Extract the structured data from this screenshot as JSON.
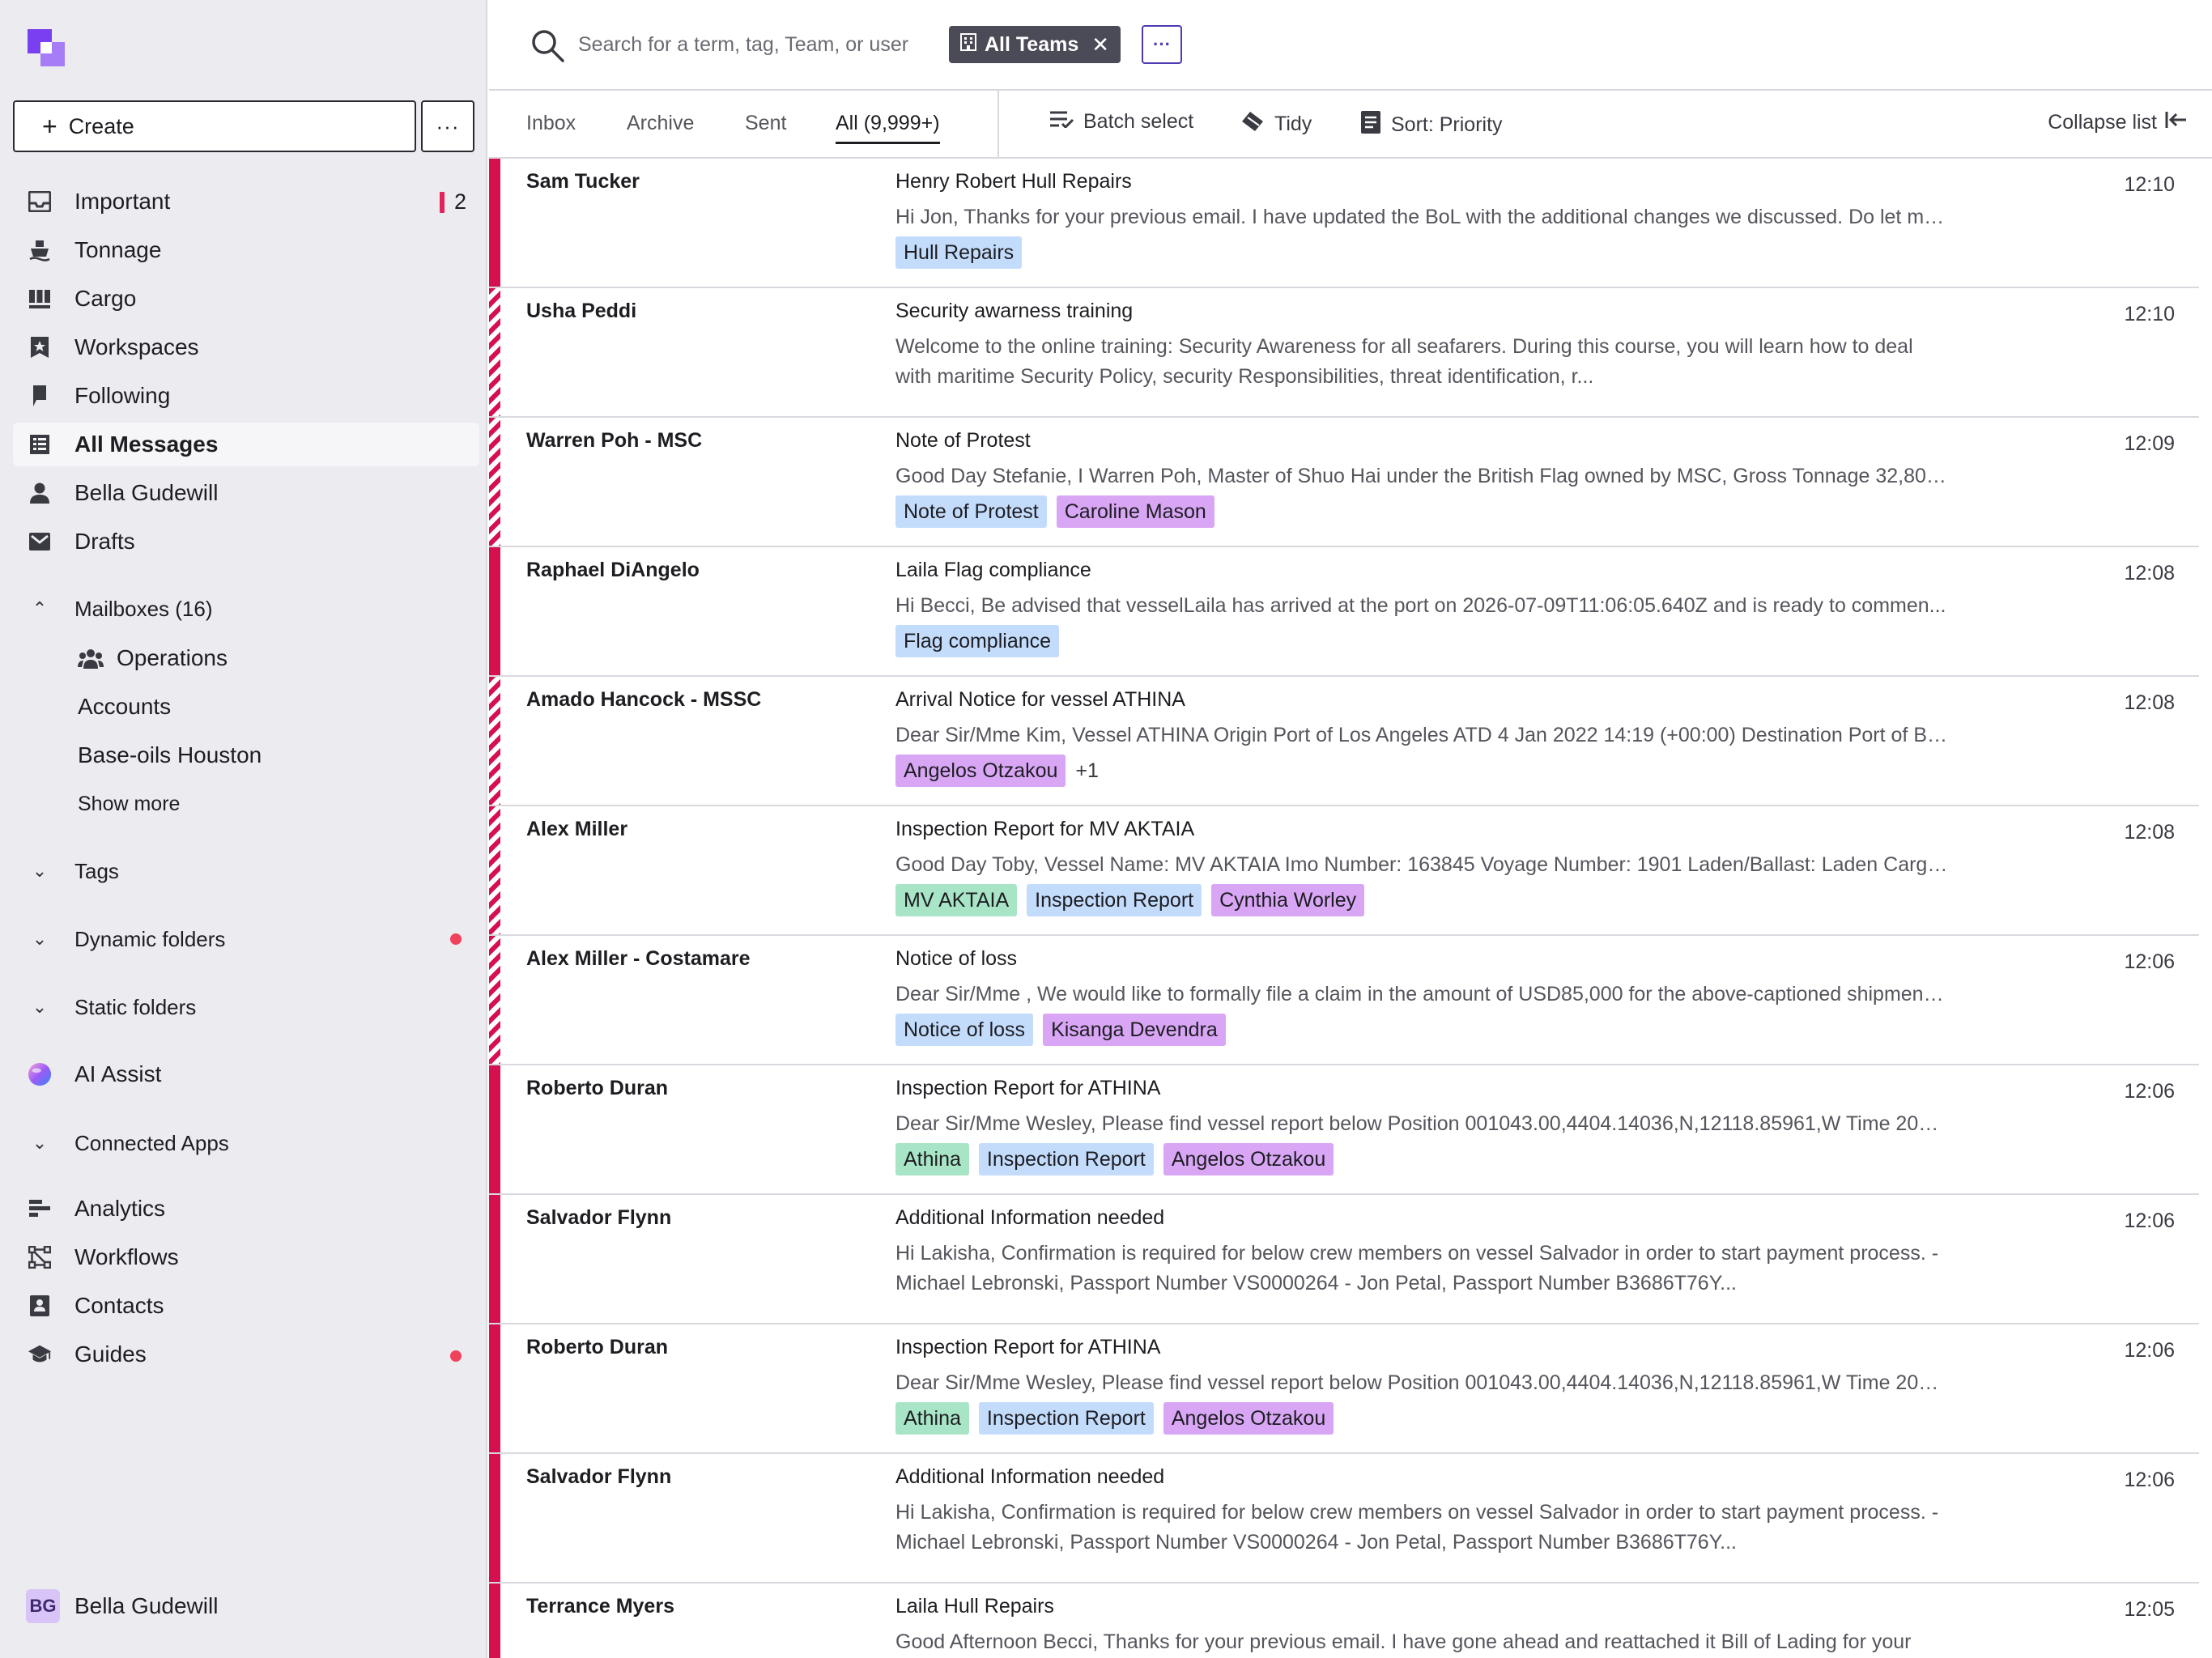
{
  "sidebar": {
    "create_label": "Create",
    "more_label": "···",
    "nav": [
      {
        "label": "Important",
        "icon": "inbox-icon",
        "count": "2"
      },
      {
        "label": "Tonnage",
        "icon": "ship-icon"
      },
      {
        "label": "Cargo",
        "icon": "cargo-icon"
      },
      {
        "label": "Workspaces",
        "icon": "workspace-star-icon"
      },
      {
        "label": "Following",
        "icon": "bookmark-icon"
      },
      {
        "label": "All Messages",
        "icon": "grid-icon",
        "active": true
      },
      {
        "label": "Bella Gudewill",
        "icon": "person-icon"
      },
      {
        "label": "Drafts",
        "icon": "envelope-icon"
      }
    ],
    "mailboxes": {
      "label": "Mailboxes (16)",
      "items": [
        "Operations",
        "Accounts",
        "Base-oils Houston"
      ],
      "show_more": "Show more"
    },
    "sections": [
      {
        "label": "Tags"
      },
      {
        "label": "Dynamic folders",
        "dot": true
      },
      {
        "label": "Static folders"
      }
    ],
    "ai_assist": "AI Assist",
    "connected_apps": "Connected Apps",
    "bottom_nav": [
      {
        "label": "Analytics",
        "icon": "analytics-icon"
      },
      {
        "label": "Workflows",
        "icon": "workflow-icon"
      },
      {
        "label": "Contacts",
        "icon": "contacts-icon"
      },
      {
        "label": "Guides",
        "icon": "graduation-cap-icon",
        "dot": true
      }
    ],
    "user": {
      "initials": "BG",
      "name": "Bella Gudewill"
    }
  },
  "search": {
    "placeholder": "Search for a term, tag, Team, or user",
    "team_chip": "All Teams"
  },
  "tabs": [
    {
      "label": "Inbox"
    },
    {
      "label": "Archive"
    },
    {
      "label": "Sent"
    },
    {
      "label": "All (9,999+)",
      "active": true
    }
  ],
  "tools": {
    "batch_select": "Batch select",
    "tidy": "Tidy",
    "sort": "Sort: Priority",
    "collapse": "Collapse list"
  },
  "colors": {
    "priority": "#d6104f",
    "accent": "#4b3bb5",
    "tag_blue": "#c4dcfb",
    "tag_purple": "#d9a6f5",
    "tag_green": "#a8e5c6"
  },
  "messages": [
    {
      "sender": "Sam Tucker",
      "subject": "Henry Robert Hull Repairs",
      "preview": "Hi Jon, Thanks for your previous email. I have updated the BoL with the additional changes we discussed. Do let me...",
      "time": "12:10",
      "priority": "solid",
      "tags": [
        {
          "label": "Hull Repairs",
          "color": "blue"
        }
      ]
    },
    {
      "sender": "Usha Peddi",
      "subject": "Security awarness training",
      "preview": "Welcome to the online training: Security Awareness for all seafarers. During this course, you will learn how to deal with maritime Security Policy, security Responsibilities, threat identification, r...",
      "time": "12:10",
      "priority": "striped",
      "tags": []
    },
    {
      "sender": "Warren Poh - MSC",
      "subject": "Note of Protest",
      "preview": "Good Day Stefanie, I Warren Poh, Master of Shuo Hai under the British Flag owned by MSC, Gross Tonnage 32,800...",
      "time": "12:09",
      "priority": "striped",
      "tags": [
        {
          "label": "Note of Protest",
          "color": "blue"
        },
        {
          "label": "Caroline Mason",
          "color": "purple"
        }
      ]
    },
    {
      "sender": "Raphael DiAngelo",
      "subject": "Laila Flag compliance",
      "preview": "Hi Becci, Be advised that vesselLaila has arrived at the port on 2026-07-09T11:06:05.640Z and is ready to commen...",
      "time": "12:08",
      "priority": "solid",
      "tags": [
        {
          "label": "Flag compliance",
          "color": "blue"
        }
      ]
    },
    {
      "sender": "Amado Hancock - MSSC",
      "subject": "Arrival Notice for vessel ATHINA",
      "preview": "Dear Sir/Mme Kim, Vessel ATHINA Origin Port of Los Angeles ATD 4 Jan 2022 14:19 (+00:00) Destination Port of Bei...",
      "time": "12:08",
      "priority": "striped",
      "tags": [
        {
          "label": "Angelos Otzakou",
          "color": "purple"
        }
      ],
      "extra": "+1"
    },
    {
      "sender": "Alex Miller",
      "subject": "Inspection Report for MV AKTAIA",
      "preview": "Good Day Toby, Vessel Name: MV AKTAIA Imo Number: 163845 Voyage Number: 1901 Laden/Ballast: Laden Cargo T...",
      "time": "12:08",
      "priority": "striped",
      "tags": [
        {
          "label": "MV AKTAIA",
          "color": "green"
        },
        {
          "label": "Inspection Report",
          "color": "blue"
        },
        {
          "label": "Cynthia Worley",
          "color": "purple"
        }
      ]
    },
    {
      "sender": "Alex Miller - Costamare",
      "subject": "Notice of loss",
      "preview": "Dear Sir/Mme , We would like to formally file a claim in the amount of USD85,000 for the above-captioned shipment ...",
      "time": "12:06",
      "priority": "striped",
      "tags": [
        {
          "label": "Notice of loss",
          "color": "blue"
        },
        {
          "label": "Kisanga Devendra",
          "color": "purple"
        }
      ]
    },
    {
      "sender": "Roberto Duran",
      "subject": "Inspection Report for ATHINA",
      "preview": "Dear Sir/Mme Wesley, Please find vessel report below Position 001043.00,4404.14036,N,12118.85961,W Time 2026-...",
      "time": "12:06",
      "priority": "solid",
      "tags": [
        {
          "label": "Athina",
          "color": "green"
        },
        {
          "label": "Inspection Report",
          "color": "blue"
        },
        {
          "label": "Angelos Otzakou",
          "color": "purple"
        }
      ]
    },
    {
      "sender": "Salvador Flynn",
      "subject": "Additional Information needed",
      "preview": "Hi Lakisha, Confirmation is required for below crew members on vessel Salvador in order to start payment process. - Michael Lebronski, Passport Number VS0000264 - Jon Petal, Passport Number B3686T76Y...",
      "time": "12:06",
      "priority": "solid",
      "tags": []
    },
    {
      "sender": "Roberto Duran",
      "subject": "Inspection Report for ATHINA",
      "preview": "Dear Sir/Mme Wesley, Please find vessel report below Position 001043.00,4404.14036,N,12118.85961,W Time 2026-...",
      "time": "12:06",
      "priority": "solid",
      "tags": [
        {
          "label": "Athina",
          "color": "green"
        },
        {
          "label": "Inspection Report",
          "color": "blue"
        },
        {
          "label": "Angelos Otzakou",
          "color": "purple"
        }
      ]
    },
    {
      "sender": "Salvador Flynn",
      "subject": "Additional Information needed",
      "preview": "Hi Lakisha, Confirmation is required for below crew members on vessel Salvador in order to start payment process. - Michael Lebronski, Passport Number VS0000264 - Jon Petal, Passport Number B3686T76Y...",
      "time": "12:06",
      "priority": "solid",
      "tags": []
    },
    {
      "sender": "Terrance Myers",
      "subject": "Laila Hull Repairs",
      "preview": "Good Afternoon Becci, Thanks for your previous email. I have gone ahead and reattached it Bill of Lading for your re...",
      "time": "12:05",
      "priority": "solid",
      "tags": []
    }
  ]
}
